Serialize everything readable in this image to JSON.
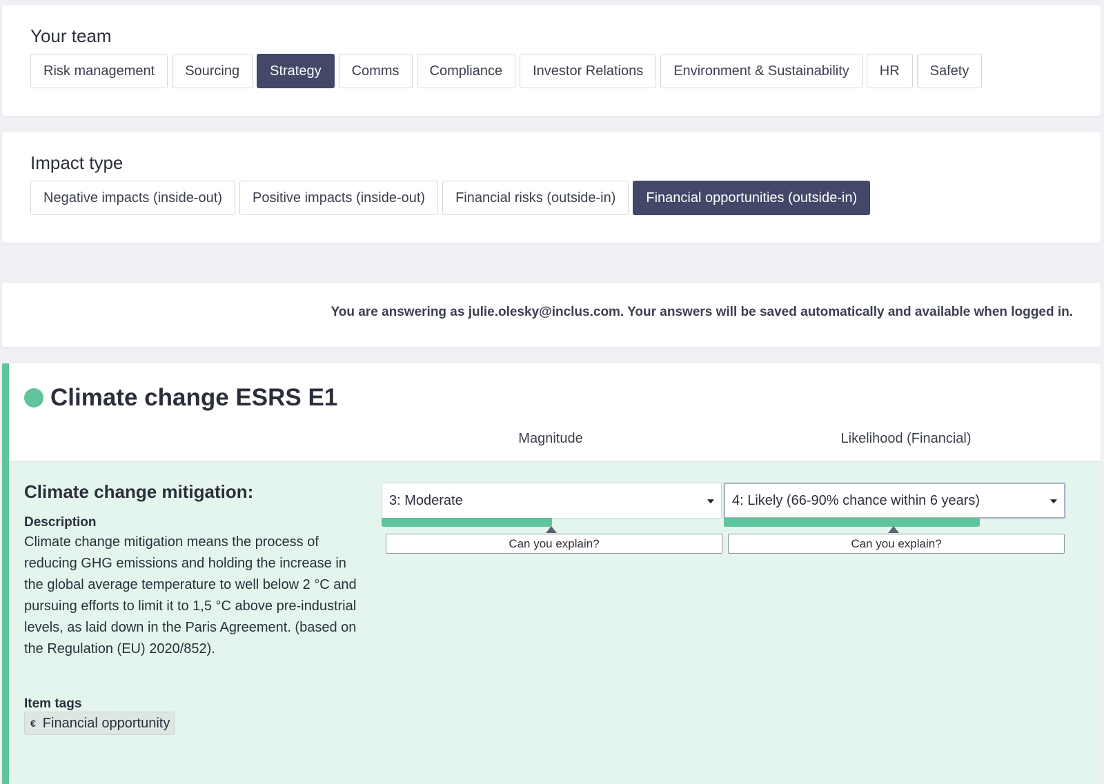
{
  "team": {
    "title": "Your team",
    "buttons": [
      "Risk management",
      "Sourcing",
      "Strategy",
      "Comms",
      "Compliance",
      "Investor Relations",
      "Environment & Sustainability",
      "HR",
      "Safety"
    ],
    "active": "Strategy"
  },
  "impact": {
    "title": "Impact type",
    "buttons": [
      "Negative impacts (inside-out)",
      "Positive impacts (inside-out)",
      "Financial risks (outside-in)",
      "Financial opportunities (outside-in)"
    ],
    "active": "Financial opportunities (outside-in)"
  },
  "notice": {
    "text": "You are answering as julie.olesky@inclus.com. Your answers will be saved automatically and available when logged in."
  },
  "topic": {
    "title": "Climate change ESRS E1",
    "dot_color": "#5fc39c",
    "columns": {
      "magnitude": "Magnitude",
      "likelihood": "Likelihood (Financial)"
    },
    "item": {
      "title": "Climate change mitigation:",
      "description_label": "Description",
      "description": "Climate change mitigation means the process of reducing GHG emissions and holding the increase in the global average temperature to well below 2 °C and pursuing efforts to limit it to 1,5 °C above pre-industrial levels, as laid down in the Paris Agreement. (based on the Regulation (EU) 2020/852).",
      "tags_label": "Item tags",
      "tag_icon": "€",
      "tag": "Financial opportunity",
      "magnitude": {
        "value": "3: Moderate",
        "level_fraction": 0.5,
        "explain_label": "Can you explain?"
      },
      "likelihood": {
        "value": "4: Likely (66-90% chance within 6 years)",
        "level_fraction": 0.75,
        "explain_label": "Can you explain?"
      }
    }
  },
  "colors": {
    "accent": "#5fc39c",
    "active_button": "#434869",
    "item_background": "#e4f5ee"
  }
}
